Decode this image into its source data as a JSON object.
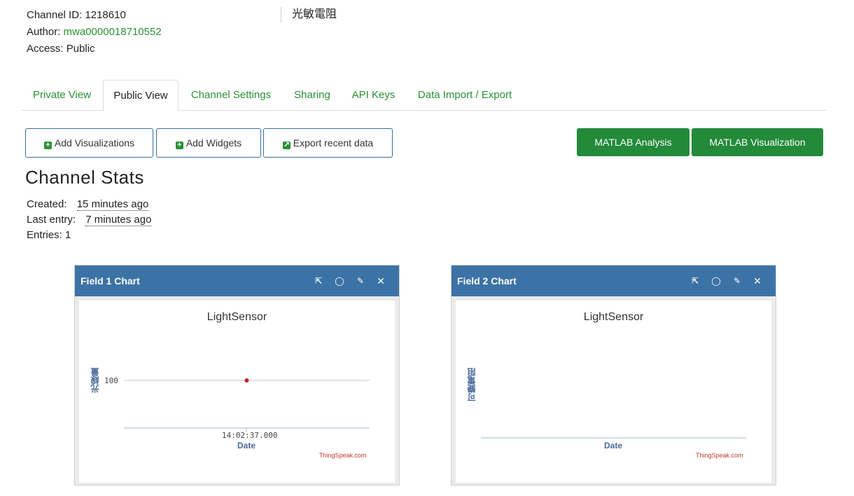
{
  "channel": {
    "id_label": "Channel ID:",
    "id": "1218610",
    "author_label": "Author:",
    "author": "mwa0000018710552",
    "access_label": "Access:",
    "access": "Public",
    "name": "光敏電阻"
  },
  "tabs": [
    {
      "label": "Private View"
    },
    {
      "label": "Public View"
    },
    {
      "label": "Channel Settings"
    },
    {
      "label": "Sharing"
    },
    {
      "label": "API Keys"
    },
    {
      "label": "Data Import / Export"
    }
  ],
  "buttons": {
    "add_visualizations": "Add Visualizations",
    "add_widgets": "Add Widgets",
    "export_recent": "Export recent data",
    "matlab_analysis": "MATLAB Analysis",
    "matlab_visualization": "MATLAB Visualization"
  },
  "stats": {
    "title": "Channel Stats",
    "created_label": "Created:",
    "created": "15 minutes ago",
    "last_entry_label": "Last entry:",
    "last_entry": "7 minutes ago",
    "entries_label": "Entries:",
    "entries": "1"
  },
  "colors": {
    "accent_green": "#2a9132",
    "button_green": "#238a3a",
    "panel_header": "#3c73a6",
    "data_point": "#c0272d"
  },
  "chart_data": [
    {
      "type": "line",
      "panel_title": "Field 1 Chart",
      "title": "LightSensor",
      "xlabel": "Date",
      "ylabel": "光線量",
      "x": [
        "14:02:37.000"
      ],
      "series": [
        {
          "values": [
            100
          ]
        }
      ],
      "y_ticks": [
        "100"
      ],
      "credit": "ThingSpeak.com"
    },
    {
      "type": "line",
      "panel_title": "Field 2 Chart",
      "title": "LightSensor",
      "xlabel": "Date",
      "ylabel": "可變電阻",
      "x": [],
      "series": [],
      "credit": "ThingSpeak.com"
    }
  ]
}
